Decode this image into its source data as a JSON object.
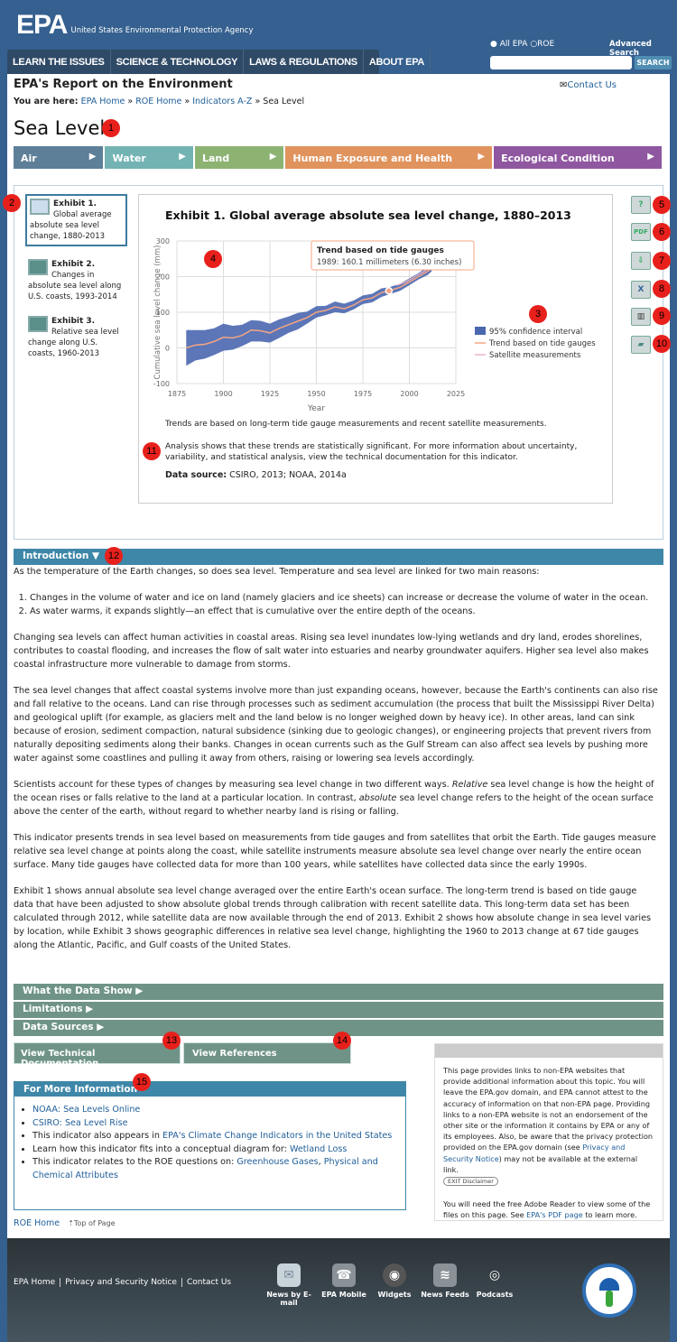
{
  "header": {
    "logo_text": "EPA",
    "agency": "United States Environmental Protection Agency",
    "nav": [
      "LEARN THE ISSUES",
      "SCIENCE & TECHNOLOGY",
      "LAWS & REGULATIONS",
      "ABOUT EPA"
    ],
    "radio_all": "All EPA",
    "radio_roe": "ROE",
    "advanced_search": "Advanced Search",
    "search_placeholder": "",
    "search_button": "SEARCH"
  },
  "site_title": "EPA's Report on the Environment",
  "contact": "Contact Us",
  "breadcrumb": {
    "prefix": "You are here:",
    "items": [
      "EPA Home",
      "ROE Home",
      "Indicators A-Z"
    ],
    "current": "Sea Level",
    "sep": "»"
  },
  "page_title": "Sea Level",
  "topics": [
    {
      "label": "Air",
      "color": "#5d7f98"
    },
    {
      "label": "Water",
      "color": "#73b3b3"
    },
    {
      "label": "Land",
      "color": "#8db373"
    },
    {
      "label": "Human Exposure and Health",
      "color": "#e0935d"
    },
    {
      "label": "Ecological Condition",
      "color": "#8f57a0"
    }
  ],
  "exhibits": [
    {
      "num": "Exhibit 1.",
      "text": "Global average absolute sea level change, 1880-2013",
      "selected": true
    },
    {
      "num": "Exhibit 2.",
      "text": "Changes in absolute sea level along U.S. coasts, 1993-2014"
    },
    {
      "num": "Exhibit 3.",
      "text": "Relative sea level change along U.S. coasts, 1960-2013"
    }
  ],
  "tools": [
    "help-icon",
    "pdf-icon",
    "download-icon",
    "excel-icon",
    "data-table-icon",
    "map-icon"
  ],
  "tool_labels": [
    "?",
    "PDF",
    "⇩",
    "X",
    "▥",
    "▰"
  ],
  "exhibit_notes": {
    "trend_note": "Trends are based on long-term tide gauge measurements and recent satellite measurements.",
    "analysis": "Analysis shows that these trends are statistically significant. For more information about uncertainty, variability, and statistical analysis, view the technical documentation for this indicator.",
    "source_label": "Data source:",
    "source": "CSIRO, 2013; NOAA, 2014a"
  },
  "chart_data": {
    "type": "line",
    "title": "Exhibit 1. Global average absolute sea level change, 1880–2013",
    "xlabel": "Year",
    "ylabel": "Cumulative sea level change (mm)",
    "xlim": [
      1875,
      2025
    ],
    "ylim": [
      -100,
      300
    ],
    "xticks": [
      1875,
      1900,
      1925,
      1950,
      1975,
      2000,
      2025
    ],
    "yticks": [
      -100,
      0,
      100,
      200,
      300
    ],
    "grid": true,
    "legend": "right",
    "colors": {
      "ci": "#4a67b0",
      "trend": "#f4a582",
      "satellite": "#e8b4cf"
    },
    "series": [
      {
        "name": "Trend based on tide gauges",
        "x": [
          1880,
          1885,
          1890,
          1895,
          1900,
          1905,
          1910,
          1915,
          1920,
          1925,
          1930,
          1935,
          1940,
          1945,
          1950,
          1955,
          1960,
          1965,
          1970,
          1975,
          1980,
          1985,
          1989,
          1995,
          2000,
          2005,
          2010,
          2012
        ],
        "y": [
          0,
          8,
          10,
          18,
          30,
          28,
          35,
          50,
          48,
          42,
          55,
          65,
          75,
          85,
          100,
          105,
          115,
          110,
          120,
          135,
          140,
          155,
          160.1,
          170,
          185,
          200,
          215,
          225
        ]
      },
      {
        "name": "95% confidence interval",
        "x": [
          1880,
          1885,
          1890,
          1895,
          1900,
          1905,
          1910,
          1915,
          1920,
          1925,
          1930,
          1935,
          1940,
          1945,
          1950,
          1955,
          1960,
          1965,
          1970,
          1975,
          1980,
          1985,
          1989,
          1995,
          2000,
          2005,
          2010,
          2012
        ],
        "lower": [
          -50,
          -35,
          -30,
          -20,
          -8,
          -5,
          5,
          18,
          18,
          15,
          28,
          42,
          52,
          68,
          85,
          92,
          100,
          97,
          108,
          123,
          128,
          143,
          150,
          160,
          176,
          192,
          205,
          215
        ],
        "upper": [
          50,
          50,
          50,
          55,
          68,
          62,
          65,
          78,
          76,
          68,
          80,
          88,
          98,
          102,
          117,
          118,
          130,
          124,
          133,
          147,
          152,
          167,
          170,
          180,
          195,
          210,
          228,
          238
        ]
      },
      {
        "name": "Satellite measurements",
        "x": [
          1993,
          1998,
          2003,
          2008,
          2013
        ],
        "y": [
          175,
          185,
          200,
          215,
          232
        ]
      }
    ],
    "tooltip": {
      "title": "Trend based on tide gauges",
      "text": "1989: 160.1 millimeters (6.30 inches)",
      "x": 1989,
      "y": 160.1
    }
  },
  "sections": {
    "intro": "Introduction",
    "what": "What the Data Show",
    "limitations": "Limitations",
    "sources": "Data Sources"
  },
  "intro": {
    "p1": "As the temperature of the Earth changes, so does sea level. Temperature and sea level are linked for two main reasons:",
    "li1": "Changes in the volume of water and ice on land (namely glaciers and ice sheets) can increase or decrease the volume of water in the ocean.",
    "li2": "As water warms, it expands slightly—an effect that is cumulative over the entire depth of the oceans.",
    "p2": "Changing sea levels can affect human activities in coastal areas. Rising sea level inundates low-lying wetlands and dry land, erodes shorelines, contributes to coastal flooding, and increases the flow of salt water into estuaries and nearby groundwater aquifers. Higher sea level also makes coastal infrastructure more vulnerable to damage from storms.",
    "p3": "The sea level changes that affect coastal systems involve more than just expanding oceans, however, because the Earth's continents can also rise and fall relative to the oceans. Land can rise through processes such as sediment accumulation (the process that built the Mississippi River Delta) and geological uplift (for example, as glaciers melt and the land below is no longer weighed down by heavy ice). In other areas, land can sink because of erosion, sediment compaction, natural subsidence (sinking due to geologic changes), or engineering projects that prevent rivers from naturally depositing sediments along their banks. Changes in ocean currents such as the Gulf Stream can also affect sea levels by pushing more water against some coastlines and pulling it away from others, raising or lowering sea levels accordingly.",
    "p4a": "Scientists account for these types of changes by measuring sea level change in two different ways. ",
    "p4b": "Relative",
    "p4c": " sea level change is how the height of the ocean rises or falls relative to the land at a particular location. In contrast, ",
    "p4d": "absolute",
    "p4e": " sea level change refers to the height of the ocean surface above the center of the earth, without regard to whether nearby land is rising or falling.",
    "p5": "This indicator presents trends in sea level based on measurements from tide gauges and from satellites that orbit the Earth. Tide gauges measure relative sea level change at points along the coast, while satellite instruments measure absolute sea level change over nearly the entire ocean surface. Many tide gauges have collected data for more than 100 years, while satellites have collected data since the early 1990s.",
    "p6": "Exhibit 1 shows annual absolute sea level change averaged over the entire Earth's ocean surface. The long-term trend is based on tide gauge data that have been adjusted to show absolute global trends through calibration with recent satellite data. This long-term data set has been calculated through 2012, while satellite data are now available through the end of 2013. Exhibit 2 shows how absolute change in sea level varies by location, while Exhibit 3 shows geographic differences in relative sea level change, highlighting the 1960 to 2013 change at 67 tide gauges along the Atlantic, Pacific, and Gulf coasts of the United States."
  },
  "buttons": {
    "tech_doc": "View Technical Documentation",
    "references": "View References"
  },
  "more_info": {
    "title": "For More Information",
    "l1": "NOAA: Sea Levels Online",
    "l2": "CSIRO: Sea Level Rise",
    "l3a": "This indicator also appears in ",
    "l3b": "EPA's Climate Change Indicators in the United States",
    "l4a": "Learn how this indicator fits into a conceptual diagram for: ",
    "l4b": "Wetland Loss",
    "l5a": "This indicator relates to the ROE questions on: ",
    "l5b": "Greenhouse Gases",
    "l5c": "Physical and Chemical Attributes"
  },
  "disclaimer": {
    "text": "This page provides links to non-EPA websites that provide additional information about this topic. You will leave the EPA.gov domain, and EPA cannot attest to the accuracy of information on that non-EPA page. Providing links to a non-EPA website is not an endorsement of the other site or the information it contains by EPA or any of its employees. Also, be aware that the privacy protection provided on the EPA.gov domain (see ",
    "link": "Privacy and Security Notice",
    "text2": ") may not be available at the external link.",
    "exit": "EXIT Disclaimer",
    "pdf_a": "You will need the free Adobe Reader to view some of the files on this page. See ",
    "pdf_link": "EPA's PDF page",
    "pdf_b": " to learn more."
  },
  "bottom": {
    "roe_home": "ROE Home",
    "top": "⇡Top of Page"
  },
  "footer": {
    "links": [
      "EPA Home",
      "Privacy and Security Notice",
      "Contact Us"
    ],
    "icons": [
      {
        "label": "News by E-mail",
        "glyph": "✉"
      },
      {
        "label": "EPA Mobile",
        "glyph": "☎"
      },
      {
        "label": "Widgets",
        "glyph": "◉"
      },
      {
        "label": "News Feeds",
        "glyph": "≋"
      },
      {
        "label": "Podcasts",
        "glyph": "◎"
      }
    ]
  },
  "annotations": [
    "1",
    "2",
    "3",
    "4",
    "5",
    "6",
    "7",
    "8",
    "9",
    "10",
    "11",
    "12",
    "13",
    "14",
    "15"
  ]
}
